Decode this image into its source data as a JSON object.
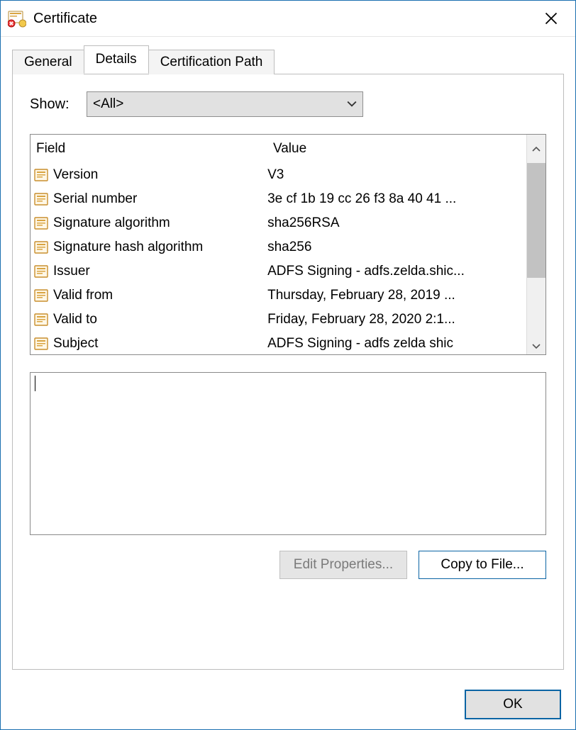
{
  "window": {
    "title": "Certificate"
  },
  "tabs": {
    "general": "General",
    "details": "Details",
    "cert_path": "Certification Path"
  },
  "show": {
    "label": "Show:",
    "value": "<All>"
  },
  "columns": {
    "field": "Field",
    "value": "Value"
  },
  "rows": [
    {
      "field": "Version",
      "value": "V3"
    },
    {
      "field": "Serial number",
      "value": "3e cf 1b 19 cc 26 f3 8a 40 41 ..."
    },
    {
      "field": "Signature algorithm",
      "value": "sha256RSA"
    },
    {
      "field": "Signature hash algorithm",
      "value": "sha256"
    },
    {
      "field": "Issuer",
      "value": "ADFS Signing - adfs.zelda.shic..."
    },
    {
      "field": "Valid from",
      "value": "Thursday, February 28, 2019 ..."
    },
    {
      "field": "Valid to",
      "value": "Friday, February 28, 2020 2:1..."
    },
    {
      "field": "Subject",
      "value": "ADFS Signing - adfs zelda shic"
    }
  ],
  "buttons": {
    "edit_properties": "Edit Properties...",
    "copy_to_file": "Copy to File...",
    "ok": "OK"
  }
}
